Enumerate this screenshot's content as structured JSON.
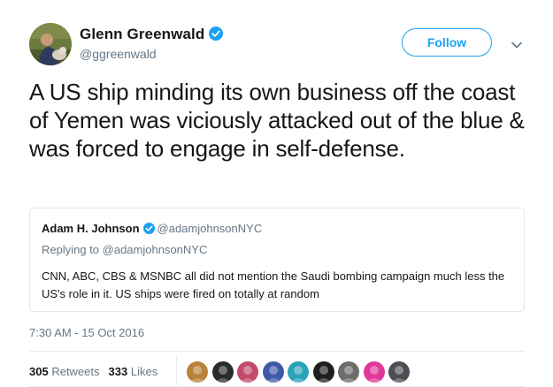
{
  "tweet": {
    "author_name": "Glenn Greenwald",
    "author_handle": "@ggreenwald",
    "follow_label": "Follow",
    "text": "A US ship minding its own business off the coast of Yemen was viciously attacked out of the blue & was forced to engage in self-defense.",
    "timestamp": "7:30 AM - 15 Oct 2016",
    "retweets_count": "305",
    "retweets_label": "Retweets",
    "likes_count": "333",
    "likes_label": "Likes"
  },
  "quoted": {
    "author_name": "Adam H. Johnson",
    "author_handle": "@adamjohnsonNYC",
    "replying_to": "Replying to @adamjohnsonNYC",
    "text": "CNN, ABC, CBS & MSNBC all did not mention the Saudi bombing campaign much less the US's role in it. US ships were fired on totally at random"
  },
  "colors": {
    "accent": "#1da1f2",
    "text": "#14171a",
    "secondary": "#657786",
    "border": "#e1e8ed"
  },
  "icons": {
    "verified": "verified-badge-icon",
    "caret": "chevron-down-icon"
  },
  "likers": [
    {
      "name": "liker-avatar-1",
      "color": "#b9823a"
    },
    {
      "name": "liker-avatar-2",
      "color": "#2b2b2b"
    },
    {
      "name": "liker-avatar-3",
      "color": "#c24a6a"
    },
    {
      "name": "liker-avatar-4",
      "color": "#3f5aa8"
    },
    {
      "name": "liker-avatar-5",
      "color": "#2aa3b8"
    },
    {
      "name": "liker-avatar-6",
      "color": "#1e1e1e"
    },
    {
      "name": "liker-avatar-7",
      "color": "#6c6c6c"
    },
    {
      "name": "liker-avatar-8",
      "color": "#e0389a"
    },
    {
      "name": "liker-avatar-9",
      "color": "#4d4d55"
    }
  ]
}
